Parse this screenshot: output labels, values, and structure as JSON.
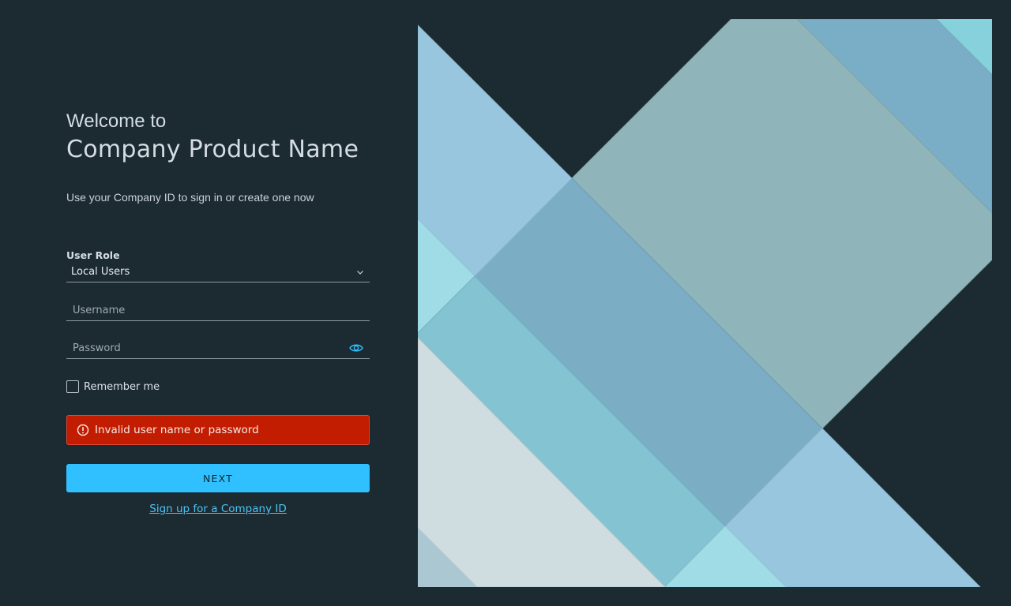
{
  "login": {
    "welcome": "Welcome to",
    "product_name": "Company Product Name",
    "subtitle": "Use your Company ID to sign in or create one now",
    "user_role_label": "User Role",
    "user_role_value": "Local Users",
    "username_placeholder": "Username",
    "password_placeholder": "Password",
    "remember_label": "Remember me",
    "remember_checked": false,
    "error_message": "Invalid user name or password",
    "next_label": "NEXT",
    "signup_link": "Sign up for a Company ID"
  },
  "colors": {
    "background": "#1c2a32",
    "accent": "#30bfff",
    "error": "#c21d00",
    "link": "#4cc3f5"
  },
  "icons": {
    "role_dropdown": "chevron-down-icon",
    "password_toggle": "eye-icon",
    "error": "exclamation-circle-icon"
  }
}
